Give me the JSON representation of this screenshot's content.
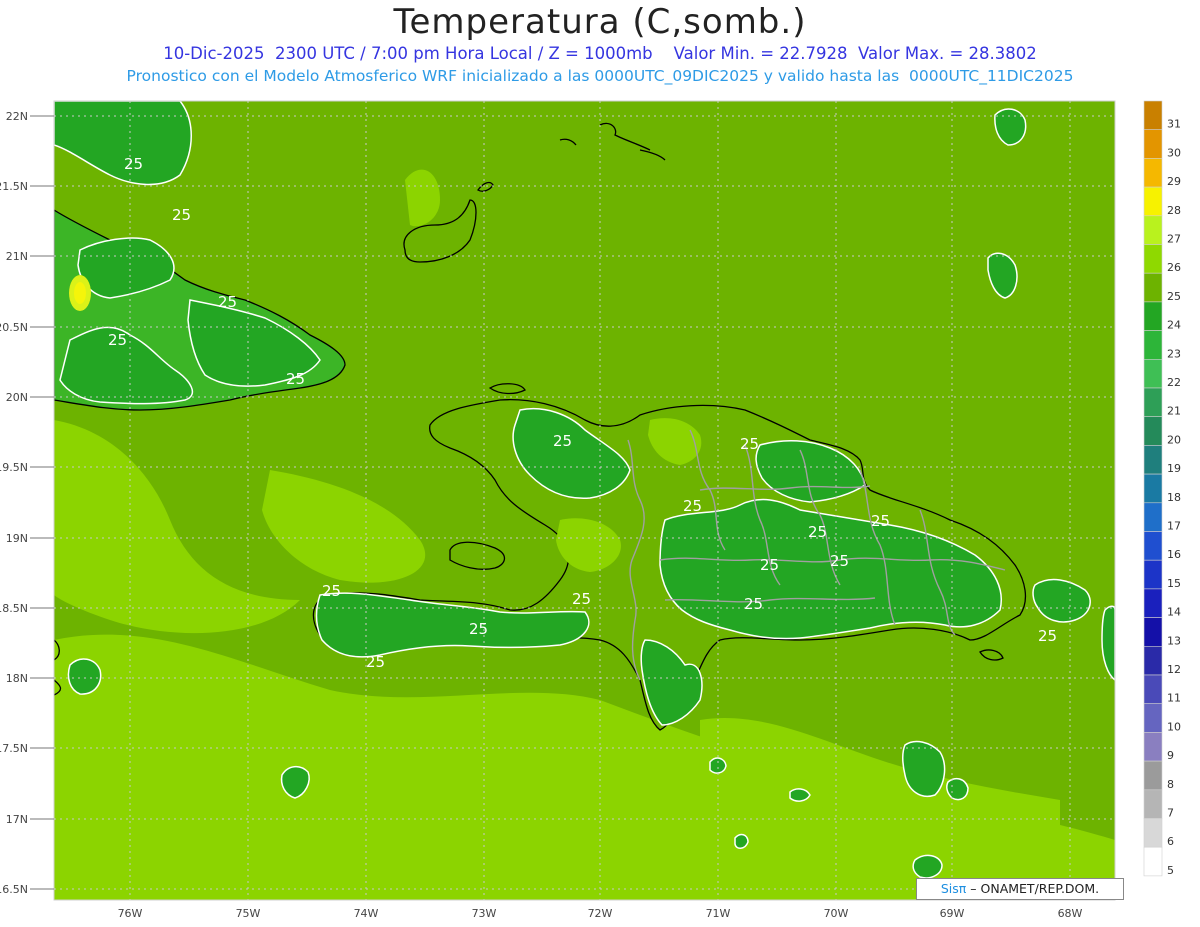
{
  "header": {
    "title": "Temperatura (C,somb.)",
    "subtitle": "10-Dic-2025  2300 UTC / 7:00 pm Hora Local / Z = 1000mb    Valor Min. = 22.7928  Valor Max. = 28.3802",
    "model_line": "Pronostico con el Modelo Atmosferico WRF inicializado a las 0000UTC_09DIC2025 y valido hasta las  0000UTC_11DIC2025"
  },
  "map": {
    "lat_labels": [
      "22N",
      "21.5N",
      "21N",
      "20.5N",
      "20N",
      "19.5N",
      "19N",
      "18.5N",
      "18N",
      "17.5N",
      "17N",
      "16.5N"
    ],
    "lon_labels": [
      "76W",
      "75W",
      "74W",
      "73W",
      "72W",
      "71W",
      "70W",
      "69W",
      "68W"
    ],
    "contour_label": "25",
    "colors": {
      "sea_background": "#6db300",
      "light_band": "#8cd400",
      "land_cool": "#23a623",
      "land_mid": "#3cb526",
      "warm_spot": "#dbf218",
      "hot_spot": "#f5f50a"
    }
  },
  "colorbar": {
    "levels": [
      "31",
      "30",
      "29",
      "28",
      "27",
      "26",
      "25",
      "24",
      "23",
      "22",
      "21",
      "20",
      "19",
      "18",
      "17",
      "16",
      "15",
      "14",
      "13",
      "12",
      "11",
      "10",
      "9",
      "8",
      "7",
      "6",
      "5"
    ],
    "colors": [
      "#c98000",
      "#e39500",
      "#f5b800",
      "#f7f200",
      "#b9f21e",
      "#8fd900",
      "#6db300",
      "#23a623",
      "#2db539",
      "#3fbf55",
      "#2e9f57",
      "#248a5a",
      "#1f7f7d",
      "#1a7aa3",
      "#1f6fc9",
      "#1f4fd0",
      "#1c34c8",
      "#1a20bd",
      "#1410a8",
      "#2a2aa8",
      "#4a4ab8",
      "#6565c0",
      "#8a7fc0",
      "#9b9b9b",
      "#b5b5b5",
      "#d8d8d8",
      "#ffffff"
    ]
  },
  "credit": {
    "brand": "Sisπ",
    "text": "– ONAMET/REP.DOM."
  }
}
